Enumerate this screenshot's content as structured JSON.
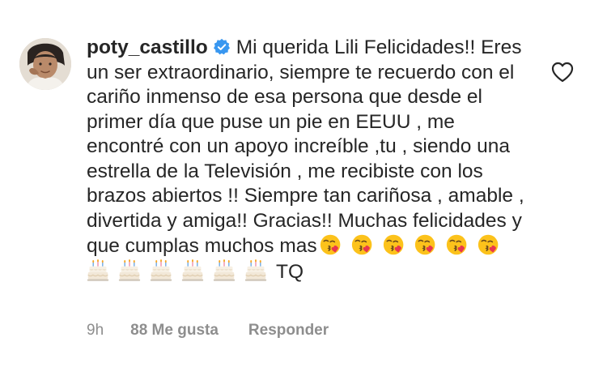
{
  "comment": {
    "username": "poty_castillo",
    "verified": true,
    "text": "Mi querida Lili Felicidades!! Eres un ser extraordinario, siempre te recuerdo con el cariño inmenso de esa persona que desde el primer día que puse un pie en EEUU , me encontré con un apoyo increíble ,tu , siendo una estrella de la Televisión , me recibiste con los brazos abiertos !! Siempre tan cariñosa , amable , divertida y amiga!! Gracias!! Muchas felicidades y que cumplas muchos mas",
    "emojis": [
      "kissing-face-emoji",
      "kissing-face-emoji",
      "kissing-face-emoji",
      "kissing-face-emoji",
      "kissing-face-emoji",
      "kissing-face-emoji",
      "birthday-cake-emoji",
      "birthday-cake-emoji",
      "birthday-cake-emoji",
      "birthday-cake-emoji",
      "birthday-cake-emoji",
      "birthday-cake-emoji"
    ],
    "suffix": "TQ",
    "like_icon": "heart-outline-icon"
  },
  "meta": {
    "time": "9h",
    "likes": "88 Me gusta",
    "reply": "Responder"
  },
  "colors": {
    "text": "#262626",
    "secondary": "#8e8e8e",
    "verified": "#3897f0"
  }
}
